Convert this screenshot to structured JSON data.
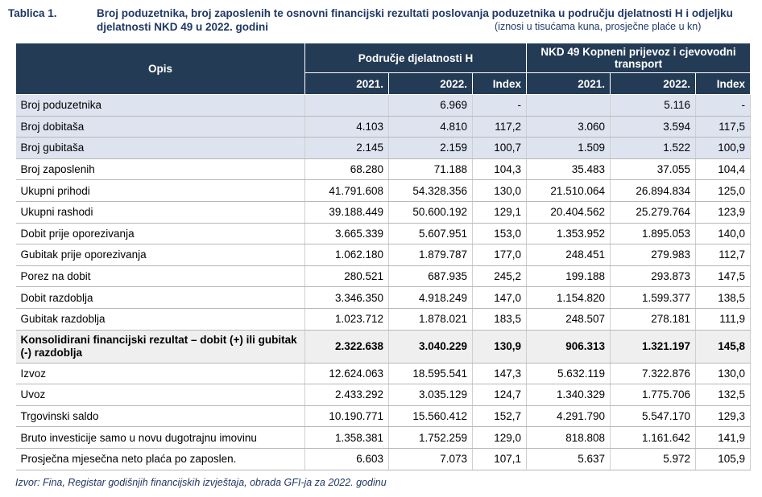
{
  "caption": {
    "label": "Tablica 1.",
    "title": "Broj poduzetnika, broj zaposlenih te osnovni financijski rezultati poslovanja poduzetnika u području djelatnosti H i odjeljku djelatnosti NKD 49 u 2022. godini",
    "note": "(iznosi u tisućama kuna, prosječne plaće u kn)"
  },
  "header": {
    "opis": "Opis",
    "group1": "Područje djelatnosti H",
    "group2": "NKD 49 Kopneni prijevoz i cjevovodni transport",
    "sub": [
      "2021.",
      "2022.",
      "Index",
      "2021.",
      "2022.",
      "Index"
    ]
  },
  "rows": [
    {
      "label": "Broj poduzetnika",
      "v": [
        "",
        "6.969",
        "-",
        "",
        "5.116",
        "-"
      ]
    },
    {
      "label": "Broj dobitaša",
      "v": [
        "4.103",
        "4.810",
        "117,2",
        "3.060",
        "3.594",
        "117,5"
      ]
    },
    {
      "label": "Broj gubitaša",
      "v": [
        "2.145",
        "2.159",
        "100,7",
        "1.509",
        "1.522",
        "100,9"
      ]
    },
    {
      "label": "Broj zaposlenih",
      "v": [
        "68.280",
        "71.188",
        "104,3",
        "35.483",
        "37.055",
        "104,4"
      ]
    },
    {
      "label": "Ukupni prihodi",
      "v": [
        "41.791.608",
        "54.328.356",
        "130,0",
        "21.510.064",
        "26.894.834",
        "125,0"
      ]
    },
    {
      "label": "Ukupni rashodi",
      "v": [
        "39.188.449",
        "50.600.192",
        "129,1",
        "20.404.562",
        "25.279.764",
        "123,9"
      ]
    },
    {
      "label": "Dobit prije oporezivanja",
      "v": [
        "3.665.339",
        "5.607.951",
        "153,0",
        "1.353.952",
        "1.895.053",
        "140,0"
      ]
    },
    {
      "label": "Gubitak prije oporezivanja",
      "v": [
        "1.062.180",
        "1.879.787",
        "177,0",
        "248.451",
        "279.983",
        "112,7"
      ]
    },
    {
      "label": "Porez na dobit",
      "v": [
        "280.521",
        "687.935",
        "245,2",
        "199.188",
        "293.873",
        "147,5"
      ]
    },
    {
      "label": "Dobit razdoblja",
      "v": [
        "3.346.350",
        "4.918.249",
        "147,0",
        "1.154.820",
        "1.599.377",
        "138,5"
      ]
    },
    {
      "label": "Gubitak razdoblja",
      "v": [
        "1.023.712",
        "1.878.021",
        "183,5",
        "248.507",
        "278.181",
        "111,9"
      ]
    },
    {
      "label": "Konsolidirani financijski rezultat – dobit (+) ili gubitak (-) razdoblja",
      "v": [
        "2.322.638",
        "3.040.229",
        "130,9",
        "906.313",
        "1.321.197",
        "145,8"
      ]
    },
    {
      "label": "Izvoz",
      "v": [
        "12.624.063",
        "18.595.541",
        "147,3",
        "5.632.119",
        "7.322.876",
        "130,0"
      ]
    },
    {
      "label": "Uvoz",
      "v": [
        "2.433.292",
        "3.035.129",
        "124,7",
        "1.340.329",
        "1.775.706",
        "132,5"
      ]
    },
    {
      "label": "Trgovinski saldo",
      "v": [
        "10.190.771",
        "15.560.412",
        "152,7",
        "4.291.790",
        "5.547.170",
        "129,3"
      ]
    },
    {
      "label": "Bruto investicije samo u novu dugotrajnu imovinu",
      "v": [
        "1.358.381",
        "1.752.259",
        "129,0",
        "818.808",
        "1.161.642",
        "141,9"
      ]
    },
    {
      "label": "Prosječna mjesečna neto plaća po zaposlen.",
      "v": [
        "6.603",
        "7.073",
        "107,1",
        "5.637",
        "5.972",
        "105,9"
      ]
    }
  ],
  "source": "Izvor: Fina, Registar godišnjih financijskih izvještaja, obrada GFI-ja za 2022. godinu"
}
